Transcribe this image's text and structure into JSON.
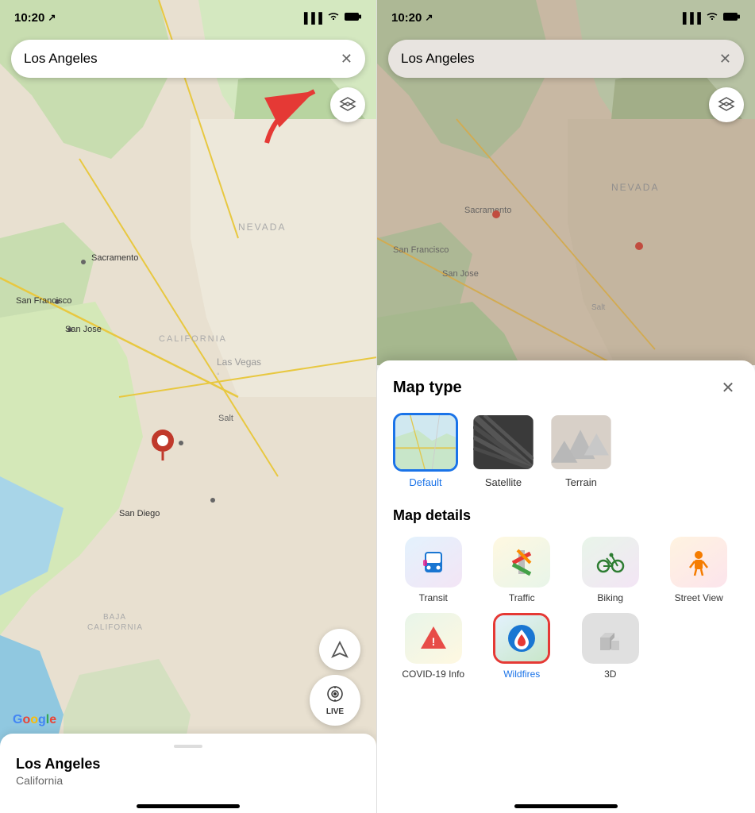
{
  "left": {
    "status": {
      "time": "10:20",
      "location_arrow": "➤"
    },
    "search": {
      "placeholder": "Los Angeles",
      "close_label": "✕"
    },
    "layers_button": {
      "icon": "⊕"
    },
    "bottom_card": {
      "title": "Los Angeles",
      "subtitle": "California"
    },
    "google_logo": "Google",
    "nav_button_icon": "➤",
    "live_button": {
      "icon": "📍",
      "label": "LIVE"
    }
  },
  "right": {
    "status": {
      "time": "10:20"
    },
    "search": {
      "placeholder": "Los Angeles",
      "close_label": "✕"
    },
    "sheet": {
      "map_type_title": "Map type",
      "map_details_title": "Map details",
      "close_label": "✕",
      "map_types": [
        {
          "id": "default",
          "label": "Default",
          "selected": true
        },
        {
          "id": "satellite",
          "label": "Satellite",
          "selected": false
        },
        {
          "id": "terrain",
          "label": "Terrain",
          "selected": false
        }
      ],
      "map_details": [
        {
          "id": "transit",
          "label": "Transit",
          "selected": false
        },
        {
          "id": "traffic",
          "label": "Traffic",
          "selected": false
        },
        {
          "id": "biking",
          "label": "Biking",
          "selected": false
        },
        {
          "id": "street-view",
          "label": "Street View",
          "selected": false
        },
        {
          "id": "covid",
          "label": "COVID-19 Info",
          "selected": false
        },
        {
          "id": "wildfires",
          "label": "Wildfires",
          "selected": true
        },
        {
          "id": "3d",
          "label": "3D",
          "selected": false
        }
      ]
    }
  }
}
